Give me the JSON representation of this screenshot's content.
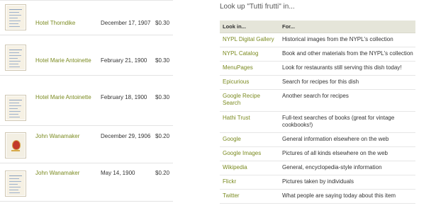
{
  "menus": [
    {
      "place": "Hotel Thorndike",
      "date": "December 17, 1907",
      "price": "$0.30",
      "thumb_icon": "menu-page-thumbnail"
    },
    {
      "place": "Hotel Marie Antoinette",
      "date": "February 21, 1900",
      "price": "$0.30",
      "thumb_icon": "menu-page-thumbnail"
    },
    {
      "place": "Hotel Marie Antoinette",
      "date": "February 18, 1900",
      "price": "$0.30",
      "thumb_icon": "menu-page-thumbnail"
    },
    {
      "place": "John Wanamaker",
      "date": "December 29, 1906",
      "price": "$0.20",
      "thumb_icon": "menu-cover-emblem-thumbnail"
    },
    {
      "place": "John Wanamaker",
      "date": "May 14, 1900",
      "price": "$0.20",
      "thumb_icon": "menu-page-thumbnail"
    }
  ],
  "lookup": {
    "heading": "Look up \"Tutti frutti\" in...",
    "col_source": "Look in...",
    "col_for": "For...",
    "rows": [
      {
        "source": "NYPL Digital Gallery",
        "for": "Historical images from the NYPL's collection"
      },
      {
        "source": "NYPL Catalog",
        "for": "Book and other materials from the NYPL's collection"
      },
      {
        "source": "MenuPages",
        "for": "Look for restaurants still serving this dish today!"
      },
      {
        "source": "Epicurious",
        "for": "Search for recipes for this dish"
      },
      {
        "source": "Google Recipe Search",
        "for": "Another search for recipes"
      },
      {
        "source": "Hathi Trust",
        "for": "Full-text searches of books (great for vintage cookbooks!)"
      },
      {
        "source": "Google",
        "for": "General information elsewhere on the web"
      },
      {
        "source": "Google Images",
        "for": "Pictures of all kinds elsewhere on the web"
      },
      {
        "source": "Wikipedia",
        "for": "General, encyclopedia-style information"
      },
      {
        "source": "Flickr",
        "for": "Pictures taken by individuals"
      },
      {
        "source": "Twitter",
        "for": "What people are saying today about this item"
      }
    ]
  },
  "colors": {
    "link": "#7a8a1f",
    "header_bg": "#e5e5d9",
    "divider": "#e3e3e3"
  }
}
